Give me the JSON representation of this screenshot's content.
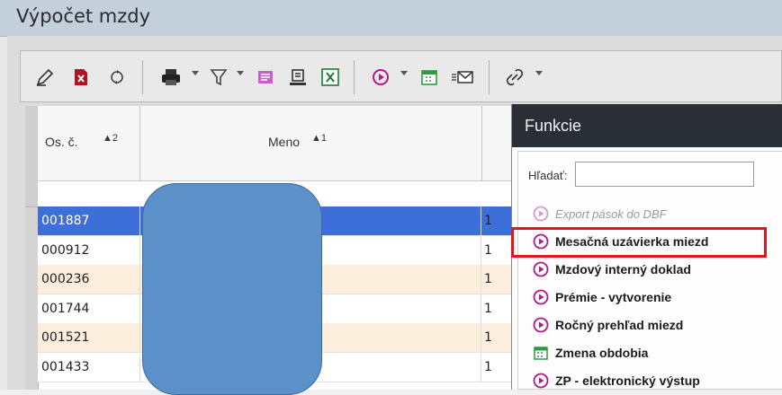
{
  "window": {
    "title": "Výpočet mzdy"
  },
  "toolbar": {
    "buttons": [
      {
        "name": "edit-icon"
      },
      {
        "name": "delete-icon"
      },
      {
        "name": "refresh-icon"
      },
      {
        "name": "print-icon"
      },
      {
        "name": "filter-icon"
      },
      {
        "name": "report-icon"
      },
      {
        "name": "export-icon"
      },
      {
        "name": "excel-icon"
      },
      {
        "name": "run-icon"
      },
      {
        "name": "calendar-icon"
      },
      {
        "name": "mail-icon"
      },
      {
        "name": "link-icon"
      }
    ]
  },
  "grid": {
    "columns": [
      {
        "label": "Os. č.",
        "sort": "▲2"
      },
      {
        "label": "Meno",
        "sort": "▲1"
      }
    ],
    "rows": [
      {
        "id": "001887",
        "val": "1",
        "selected": true
      },
      {
        "id": "000912",
        "val": "1"
      },
      {
        "id": "000236",
        "val": "1"
      },
      {
        "id": "001744",
        "val": "1"
      },
      {
        "id": "001521",
        "val": "1"
      },
      {
        "id": "001433",
        "val": "1"
      }
    ]
  },
  "panel": {
    "title": "Funkcie",
    "search_label": "Hľadať:",
    "search_value": "",
    "items": [
      {
        "label": "Export pások do DBF",
        "icon": "play-icon",
        "dim": true
      },
      {
        "label": "Mesačná uzávierka miezd",
        "icon": "play-icon",
        "highlighted": true
      },
      {
        "label": "Mzdový interný doklad",
        "icon": "play-icon"
      },
      {
        "label": "Prémie - vytvorenie",
        "icon": "play-icon"
      },
      {
        "label": "Ročný prehľad miezd",
        "icon": "play-icon"
      },
      {
        "label": "Zmena obdobia",
        "icon": "calendar-icon"
      },
      {
        "label": "ZP - elektronický výstup",
        "icon": "play-icon"
      }
    ]
  },
  "colors": {
    "selected_row": "#3e6fd8",
    "alt_row": "#fbeedd",
    "play": "#b0198c",
    "highlight": "#e0151d"
  }
}
